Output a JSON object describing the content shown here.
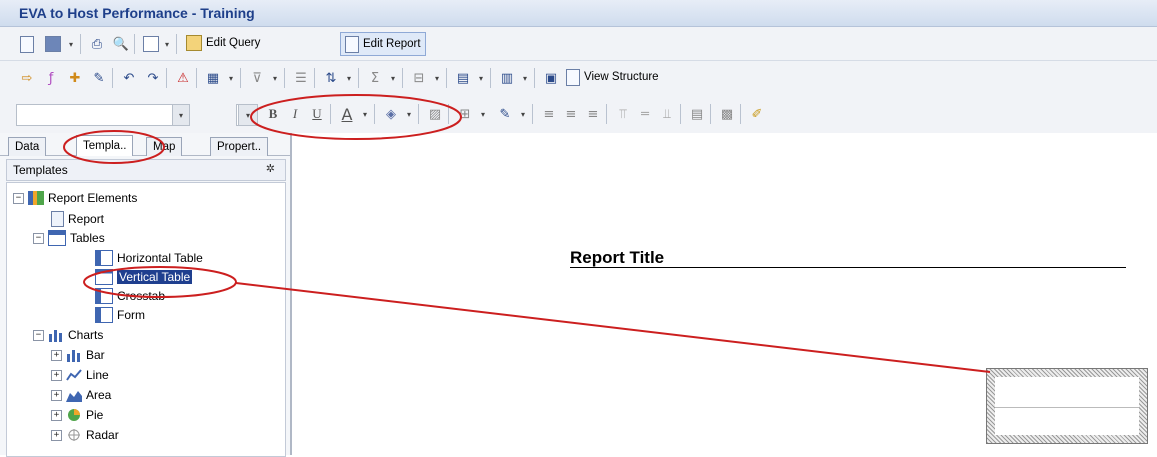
{
  "window": {
    "title": "EVA to Host Performance - Training"
  },
  "toolbar1": {
    "edit_query_label": "Edit Query",
    "edit_report_label": "Edit Report"
  },
  "toolbar2": {
    "view_structure_label": "View Structure"
  },
  "toolbar3": {
    "bold_label": "B",
    "italic_label": "I",
    "underline_label": "U",
    "font_color_label": "A"
  },
  "left_panel": {
    "tabs": [
      "Data",
      "Templa..",
      "Map",
      "Propert.."
    ],
    "header": "Templates",
    "pin": "✲",
    "tree": {
      "report_elements": "Report Elements",
      "report": "Report",
      "tables": "Tables",
      "horizontal_table": "Horizontal Table",
      "vertical_table": "Vertical Table",
      "crosstab": "Crosstab",
      "form": "Form",
      "charts": "Charts",
      "bar": "Bar",
      "line": "Line",
      "area": "Area",
      "pie": "Pie",
      "radar": "Radar"
    }
  },
  "editor": {
    "report_title": "Report Title"
  },
  "annotation_color": "#cc1f1f"
}
